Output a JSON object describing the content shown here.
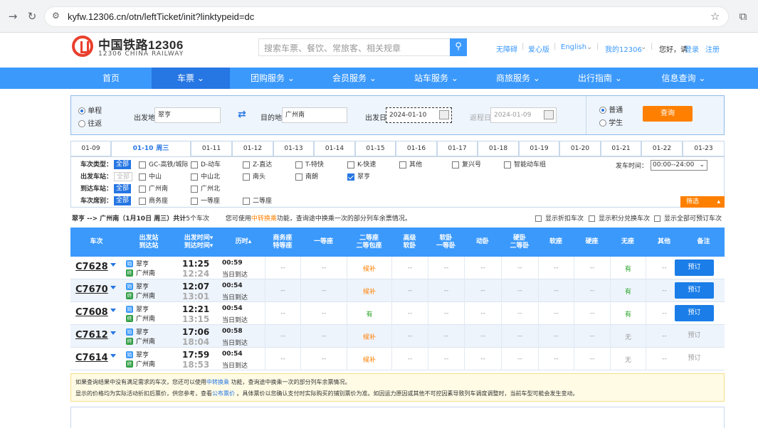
{
  "browser": {
    "url": "kyfw.12306.cn/otn/leftTicket/init?linktypeid=dc"
  },
  "header": {
    "logo_cn": "中国铁路12306",
    "logo_en": "12306 CHINA RAILWAY",
    "search_placeholder": "搜索车票、餐饮、常旅客、相关规章",
    "links": [
      "无障碍",
      "爱心版",
      "English",
      "我的12306"
    ],
    "greeting": "您好，请",
    "login": "登录",
    "register": "注册"
  },
  "nav": {
    "items": [
      "首页",
      "车票",
      "团购服务",
      "会员服务",
      "站车服务",
      "商旅服务",
      "出行指南",
      "信息查询"
    ]
  },
  "query": {
    "trip_types": [
      "单程",
      "往返"
    ],
    "from_label": "出发地",
    "from_value": "翠亨",
    "to_label": "目的地",
    "to_value": "广州南",
    "date_label": "出发日",
    "date_value": "2024-01-10",
    "return_label": "返程日",
    "return_value": "2024-01-09",
    "passenger_types": [
      "普通",
      "学生"
    ],
    "query_button": "查询"
  },
  "date_tabs": [
    "01-09",
    "01-10",
    "01-11",
    "01-12",
    "01-13",
    "01-14",
    "01-15",
    "01-16",
    "01-17",
    "01-18",
    "01-19",
    "01-20",
    "01-21",
    "01-22",
    "01-23"
  ],
  "active_weekday": "周三",
  "filter": {
    "type_label": "车次类型：",
    "all": "全部",
    "types": [
      "GC-高铁/城际",
      "D-动车",
      "Z-直达",
      "T-特快",
      "K-快速",
      "其他",
      "复兴号",
      "智能动车组"
    ],
    "from_station_label": "出发车站：",
    "from_stations": [
      "中山",
      "中山北",
      "南头",
      "南朗",
      "翠亨"
    ],
    "to_station_label": "到达车站：",
    "to_stations": [
      "广州南",
      "广州北"
    ],
    "seat_label": "车次席别：",
    "seats": [
      "商务座",
      "一等座",
      "二等座"
    ],
    "depart_time_label": "发车时间：",
    "depart_time_value": "00:00--24:00",
    "screen_button": "筛选"
  },
  "route": {
    "text_a": "翠亨 --> 广州南（1月10日 周三）共计",
    "count": "5",
    "text_b": "个车次",
    "hint_a": "您可使用",
    "hint_link": "中转换乘",
    "hint_b": "功能，查询途中换乘一次的部分列车余票情况。",
    "options": [
      "显示折扣车次",
      "显示积分兑换车次",
      "显示全部可预订车次"
    ]
  },
  "table": {
    "headers": [
      "车次",
      "出发站\n到达站",
      "出发时间▾\n到达时间▾",
      "历时▴",
      "商务座\n特等座",
      "一等座",
      "二等座\n二等包座",
      "高级\n软卧",
      "软卧\n一等卧",
      "动卧",
      "硬卧\n二等卧",
      "软座",
      "硬座",
      "无座",
      "其他",
      "备注"
    ],
    "rows": [
      {
        "no": "C7628",
        "from": "翠亨",
        "to": "广州南",
        "dep": "11:25",
        "arr": "12:24",
        "dur": "00:59",
        "day": "当日到达",
        "cells": [
          "--",
          "--",
          "候补",
          "--",
          "--",
          "--",
          "--",
          "--",
          "--",
          "有",
          "--"
        ],
        "action": "预订",
        "bookable": true
      },
      {
        "no": "C7670",
        "from": "翠亨",
        "to": "广州南",
        "dep": "12:07",
        "arr": "13:01",
        "dur": "00:54",
        "day": "当日到达",
        "cells": [
          "--",
          "--",
          "候补",
          "--",
          "--",
          "--",
          "--",
          "--",
          "--",
          "有",
          "--"
        ],
        "action": "预订",
        "bookable": true
      },
      {
        "no": "C7608",
        "from": "翠亨",
        "to": "广州南",
        "dep": "12:21",
        "arr": "13:15",
        "dur": "00:54",
        "day": "当日到达",
        "cells": [
          "--",
          "--",
          "有",
          "--",
          "--",
          "--",
          "--",
          "--",
          "--",
          "有",
          "--"
        ],
        "action": "预订",
        "bookable": true
      },
      {
        "no": "C7612",
        "from": "翠亨",
        "to": "广州南",
        "dep": "17:06",
        "arr": "18:04",
        "dur": "00:58",
        "day": "当日到达",
        "cells": [
          "--",
          "--",
          "候补",
          "--",
          "--",
          "--",
          "--",
          "--",
          "--",
          "无",
          "--"
        ],
        "action": "预订",
        "bookable": false
      },
      {
        "no": "C7614",
        "from": "翠亨",
        "to": "广州南",
        "dep": "17:59",
        "arr": "18:53",
        "dur": "00:54",
        "day": "当日到达",
        "cells": [
          "--",
          "--",
          "候补",
          "--",
          "--",
          "--",
          "--",
          "--",
          "--",
          "无",
          "--"
        ],
        "action": "预订",
        "bookable": false
      }
    ]
  },
  "notice": {
    "line1_a": "如果查询结果中没有满足需求的车次，您还可以使用",
    "line1_link": "中转换乘",
    "line1_b": " 功能，查询途中换乘一次的部分列车余票情况。",
    "line2_a": "显示的价格均为实际活动折扣后票价，供您参考，查看",
    "line2_link": "公布票价",
    "line2_b": " 。具体票价以您确认支付时实际购买的铺别票价为准。如因运力原因或其他不可控因素导致列车调度调整时，当前车型可能会发生变动。"
  },
  "colors": {
    "primary": "#3b99fc",
    "active_nav": "#2676e3",
    "orange": "#ff8000",
    "green": "#28a428",
    "logo_red": "#e9402d"
  }
}
